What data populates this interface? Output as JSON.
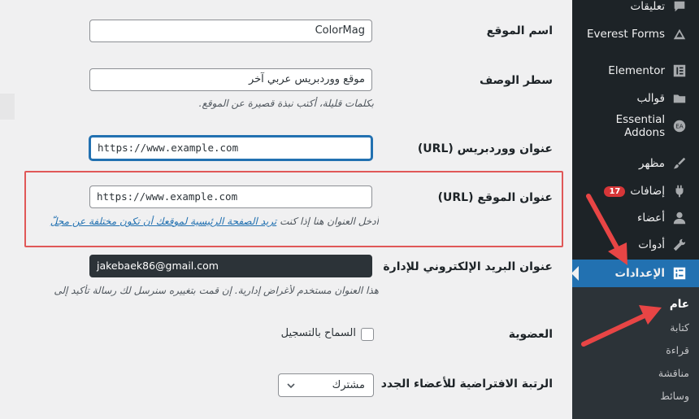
{
  "sidebar": {
    "items": [
      {
        "label": "تعليقات",
        "icon": "comment-icon"
      },
      {
        "label": "Everest Forms",
        "icon": "everest-forms-icon"
      },
      {
        "label": "Elementor",
        "icon": "elementor-icon"
      },
      {
        "label": "قوالب",
        "icon": "folder-icon"
      },
      {
        "label": "Essential Addons",
        "icon": "essential-addons-icon"
      },
      {
        "label": "مظهر",
        "icon": "brush-icon"
      },
      {
        "label": "إضافات",
        "icon": "plugin-icon",
        "badge": "17"
      },
      {
        "label": "أعضاء",
        "icon": "user-icon"
      },
      {
        "label": "أدوات",
        "icon": "wrench-icon"
      },
      {
        "label": "الإعدادات",
        "icon": "settings-icon",
        "active": true
      }
    ],
    "submenu": [
      "عام",
      "كتابة",
      "قراءة",
      "مناقشة",
      "وسائط"
    ],
    "accent": "#2271b1",
    "badge_color": "#d63638"
  },
  "form": {
    "site_title": {
      "label": "اسم الموقع",
      "value": "ColorMag"
    },
    "tagline": {
      "label": "سطر الوصف",
      "value": "موقع ووردبريس عربي آخر",
      "description": "بكلمات قليلة، أكتب نبذة قصيرة عن الموقع."
    },
    "wp_address": {
      "label": "عنوان ووردبريس (URL)",
      "value": "https://www.example.com"
    },
    "site_address": {
      "label": "عنوان الموقع (URL)",
      "value": "https://www.example.com",
      "description_prefix": "أدخل العنوان هنا إذا كنت ",
      "description_link": "تريد الصفحة الرئيسية لموقعك أن تكون مختلفة عن مجلّ"
    },
    "admin_email": {
      "label": "عنوان البريد الإلكتروني للإدارة",
      "value": "jakebaek86@gmail.com",
      "description": "هذا العنوان مستخدم لأغراض إدارية. إن قمت بتغييره سنرسل لك رسالة تأكيد إلى"
    },
    "membership": {
      "label": "العضوية",
      "checkbox_label": "السماح بالتسجيل"
    },
    "default_role": {
      "label": "الرتبة الافتراضية للأعضاء الجدد",
      "selected": "مشترك"
    }
  },
  "annotation_color": "#e05858"
}
